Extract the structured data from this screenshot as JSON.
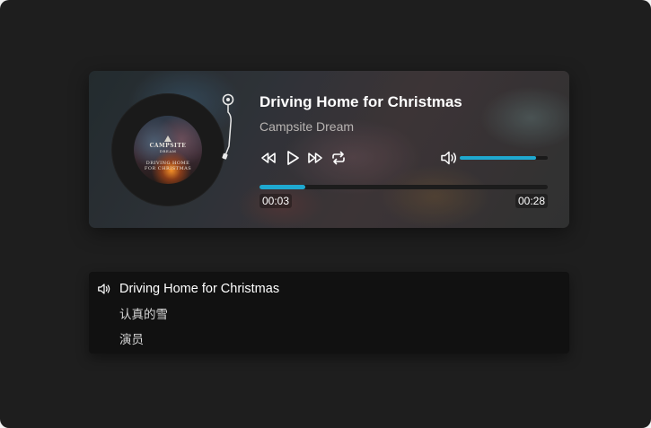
{
  "player": {
    "title": "Driving Home for Christmas",
    "artist": "Campsite Dream",
    "current_time": "00:03",
    "duration": "00:28",
    "progress_fraction": 0.16,
    "volume_fraction": 0.87,
    "accent_color": "#1fa9d0",
    "cover": {
      "line1": "CAMPSITE",
      "line2": "DREAM",
      "line3": "DRIVING HOME",
      "line4": "FOR CHRISTMAS"
    },
    "controls": [
      "rewind-icon",
      "play-icon",
      "fast-forward-icon",
      "repeat-icon",
      "volume-icon",
      "tonearm-icon"
    ]
  },
  "playlist": {
    "items": [
      {
        "label": "Driving Home for Christmas",
        "active": true
      },
      {
        "label": "认真的雪",
        "active": false
      },
      {
        "label": "演员",
        "active": false
      }
    ]
  }
}
